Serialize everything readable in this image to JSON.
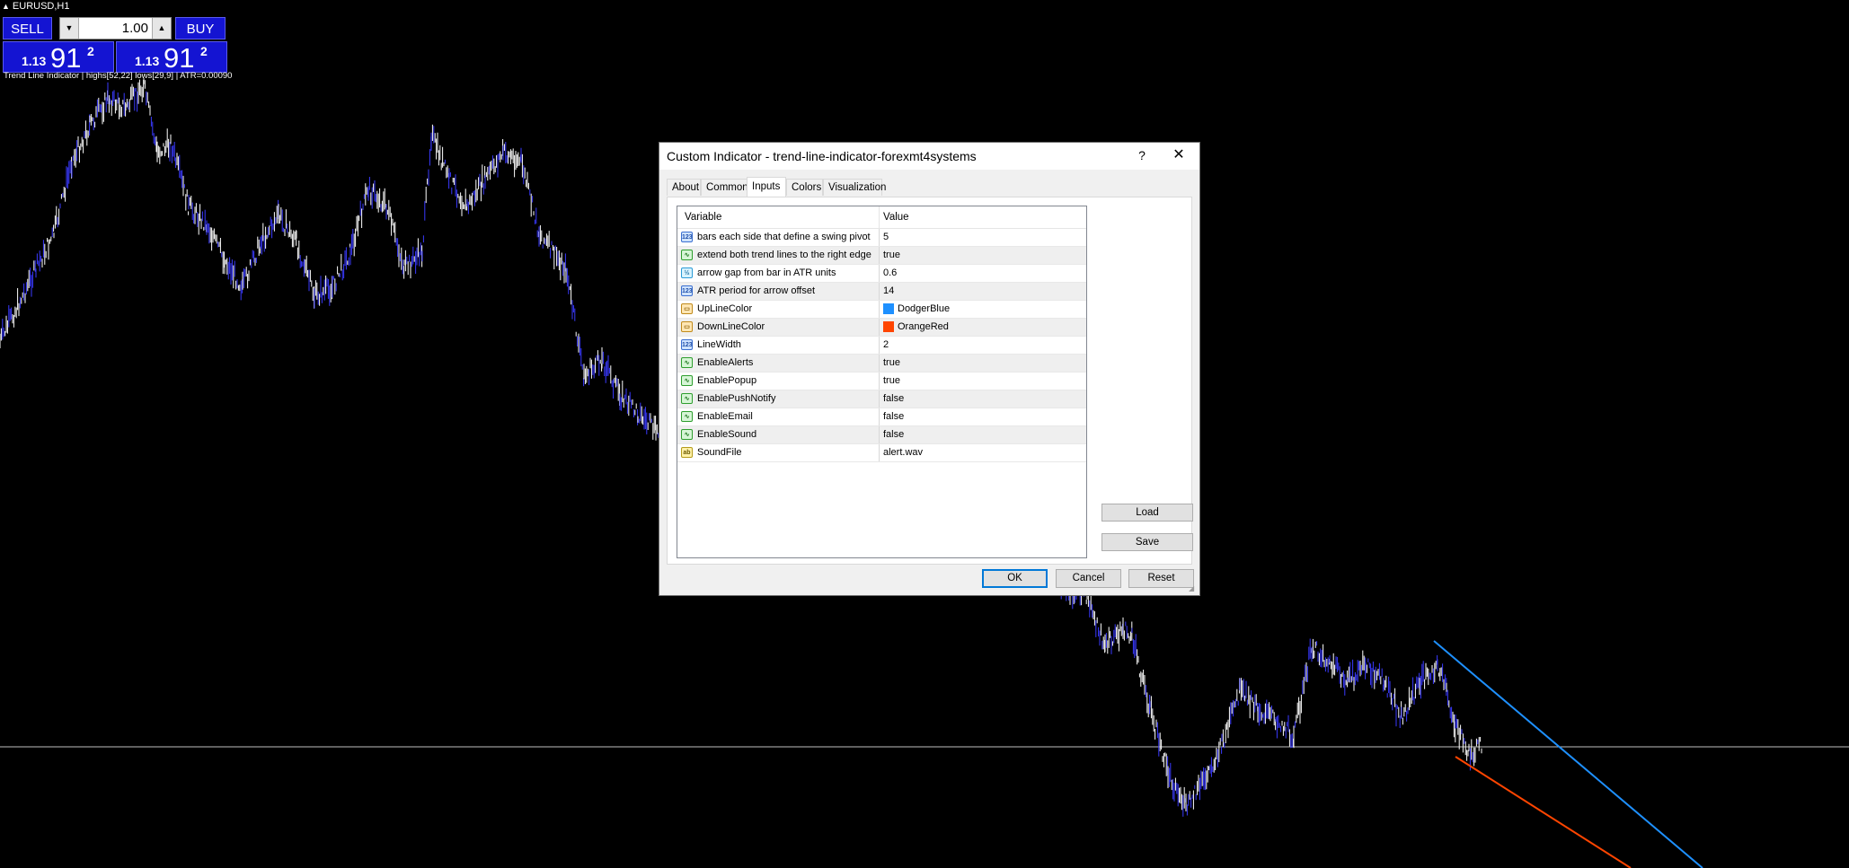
{
  "chart": {
    "symbol": "EURUSD,H1",
    "indicator_label": "Trend Line Indicator | highs[52,22] lows[29,9] | ATR=0.00090",
    "colors": {
      "background": "#000000",
      "bars": "#ffffff",
      "up_line": "#1e90ff",
      "down_line": "#ff4500",
      "price_line": "#c0c0c0"
    }
  },
  "trade_panel": {
    "sell_label": "SELL",
    "buy_label": "BUY",
    "lot": "1.00",
    "bid": {
      "small": "1.13",
      "big": "91",
      "sup": "2"
    },
    "ask": {
      "small": "1.13",
      "big": "91",
      "sup": "2"
    }
  },
  "dialog": {
    "title": "Custom Indicator - trend-line-indicator-forexmt4systems",
    "help": "?",
    "close": "✕",
    "tabs": [
      "About",
      "Common",
      "Inputs",
      "Colors",
      "Visualization"
    ],
    "active_tab": "Inputs",
    "columns": {
      "variable": "Variable",
      "value": "Value"
    },
    "params": [
      {
        "type": "int",
        "icon_text": "123",
        "name": "bars each side that define a swing pivot",
        "value": "5"
      },
      {
        "type": "bool",
        "icon_text": "∿",
        "name": "extend both trend lines to the right edge",
        "value": "true"
      },
      {
        "type": "dbl",
        "icon_text": "½",
        "name": "arrow gap from bar in ATR units",
        "value": "0.6"
      },
      {
        "type": "int",
        "icon_text": "123",
        "name": "ATR period for arrow offset",
        "value": "14"
      },
      {
        "type": "color",
        "icon_text": "▭",
        "name": "UpLineColor",
        "value": "DodgerBlue",
        "swatch": "#1e90ff"
      },
      {
        "type": "color",
        "icon_text": "▭",
        "name": "DownLineColor",
        "value": "OrangeRed",
        "swatch": "#ff4500"
      },
      {
        "type": "int",
        "icon_text": "123",
        "name": "LineWidth",
        "value": "2"
      },
      {
        "type": "bool",
        "icon_text": "∿",
        "name": "EnableAlerts",
        "value": "true"
      },
      {
        "type": "bool",
        "icon_text": "∿",
        "name": "EnablePopup",
        "value": "true"
      },
      {
        "type": "bool",
        "icon_text": "∿",
        "name": "EnablePushNotify",
        "value": "false"
      },
      {
        "type": "bool",
        "icon_text": "∿",
        "name": "EnableEmail",
        "value": "false"
      },
      {
        "type": "bool",
        "icon_text": "∿",
        "name": "EnableSound",
        "value": "false"
      },
      {
        "type": "str",
        "icon_text": "ab",
        "name": "SoundFile",
        "value": "alert.wav"
      }
    ],
    "buttons": {
      "load": "Load",
      "save": "Save",
      "ok": "OK",
      "cancel": "Cancel",
      "reset": "Reset"
    }
  }
}
